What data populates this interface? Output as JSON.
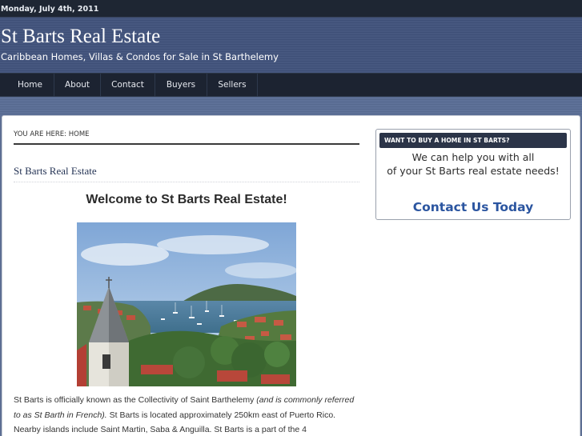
{
  "date": "Monday, July 4th, 2011",
  "header": {
    "site_title": "St Barts Real Estate",
    "site_description": "Caribbean Homes, Villas & Condos for Sale in St Barthelemy"
  },
  "nav": {
    "items": [
      {
        "label": "Home"
      },
      {
        "label": "About"
      },
      {
        "label": "Contact"
      },
      {
        "label": "Buyers"
      },
      {
        "label": "Sellers"
      }
    ]
  },
  "breadcrumb": "YOU ARE HERE: HOME",
  "post": {
    "title": "St Barts Real Estate",
    "welcome": "Welcome to St Barts Real Estate!",
    "image_alt": "harbor view with church steeple",
    "text_1": "St Barts is officially known as the Collectivity of Saint Barthelemy ",
    "text_italic": "(and is commonly referred to as St Barth in French).",
    "text_2": " St Barts is located approximately 250km east of Puerto Rico. Nearby islands include Saint Martin, Saba & Anguilla. St Barts is a part of the 4"
  },
  "sidebar": {
    "widget_title": "WANT TO BUY A HOME IN ST BARTS?",
    "line_1": "We can help you with all",
    "line_2": "of your St Barts real estate needs!",
    "cta": "Contact Us Today"
  },
  "colors": {
    "header_bg": "#46577f",
    "nav_bg": "#1c2331",
    "cta_link": "#2b55a0",
    "widget_title_bg": "#2b3448"
  }
}
